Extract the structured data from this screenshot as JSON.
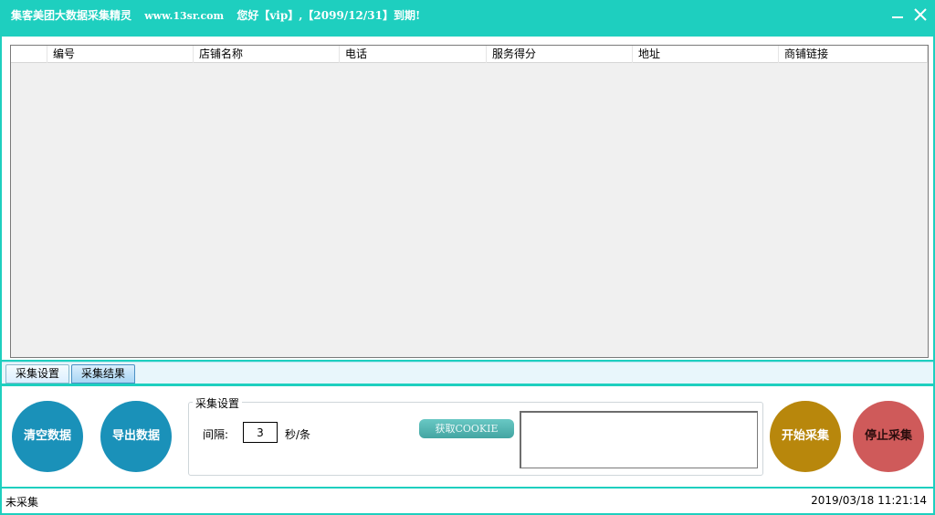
{
  "window": {
    "title": "集客美团大数据采集精灵",
    "site": "www.13sr.com",
    "greeting": "您好【vip】,【2099/12/31】到期!",
    "minimize_icon": "minimize-icon",
    "close_icon": "close-icon"
  },
  "table": {
    "columns": [
      "编号",
      "店铺名称",
      "电话",
      "服务得分",
      "地址",
      "商铺链接"
    ],
    "rows": []
  },
  "tabs": [
    {
      "label": "采集设置",
      "active": false
    },
    {
      "label": "采集结果",
      "active": true
    }
  ],
  "controls": {
    "clear_label": "清空数据",
    "export_label": "导出数据",
    "start_label": "开始采集",
    "stop_label": "停止采集",
    "group_title": "采集设置",
    "interval_label": "间隔:",
    "interval_value": "3",
    "interval_unit": "秒/条",
    "cookie_button": "获取COOKIE",
    "cookie_text": ""
  },
  "status": {
    "state": "未采集",
    "datetime": "2019/03/18 11:21:14"
  },
  "colors": {
    "frame": "#1ecfbf",
    "blue_button": "#1a91b9",
    "start_button": "#b8870c",
    "stop_button": "#cf5a5a"
  }
}
